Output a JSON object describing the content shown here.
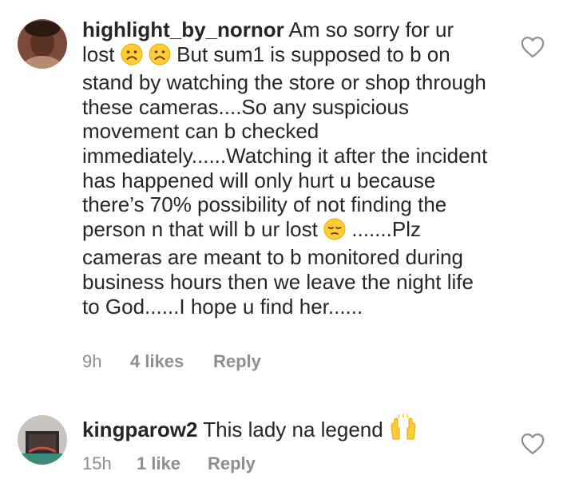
{
  "comments": [
    {
      "username": "highlight_by_nornor",
      "text_parts": [
        " Am so sorry for ur lost",
        " But sum1 is supposed to b on stand by watching the store or shop through these cameras....So any suspicious movement can b checked immediately......Watching it after the incident has happened will only hurt u because there’s 70% possibility of not finding the person n that will b ur lost ",
        ".......Plz cameras are meant to b monitored during business hours then we leave the night life to God......I hope u find her......"
      ],
      "emoji": [
        "frowning-face-emoji",
        "frowning-face-emoji",
        "pensive-face-emoji"
      ],
      "time": "9h",
      "likes": "4 likes",
      "reply_label": "Reply",
      "like_icon": "heart-outline-icon"
    },
    {
      "username": "kingparow2",
      "text": " This lady na legend ",
      "emoji": [
        "raising-hands-emoji"
      ],
      "time": "15h",
      "likes": "1 like",
      "reply_label": "Reply",
      "like_icon": "heart-outline-icon"
    }
  ],
  "colors": {
    "text": "#262626",
    "meta": "#8e8e8e",
    "emoji_yellow": "#FFCC33"
  }
}
